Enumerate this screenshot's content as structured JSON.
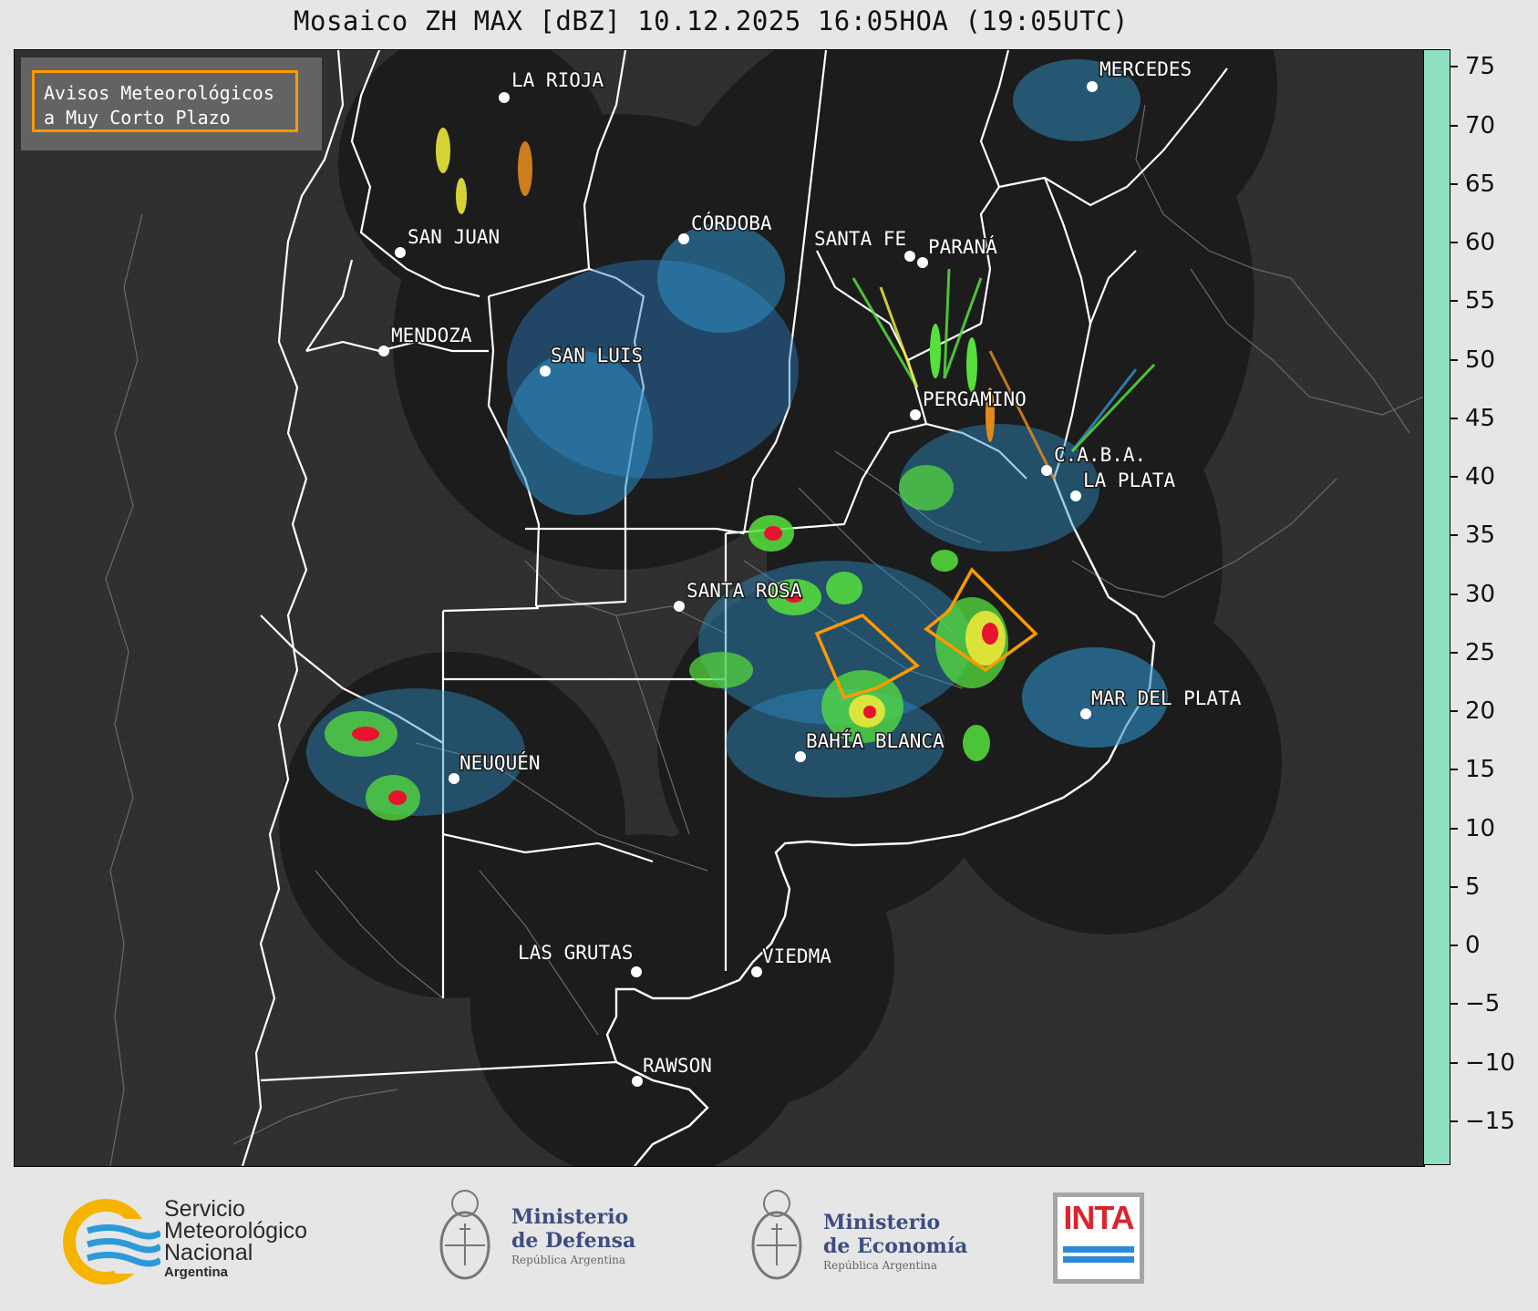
{
  "title": "Mosaico ZH MAX [dBZ] 10.12.2025 16:05HOA (19:05UTC)",
  "legend": {
    "line1": "Avisos Meteorológicos",
    "line2": "a Muy Corto Plazo",
    "border_color": "#ff9900"
  },
  "colorbar": {
    "ticks": [
      "75",
      "70",
      "65",
      "60",
      "55",
      "50",
      "45",
      "40",
      "35",
      "30",
      "25",
      "20",
      "15",
      "10",
      "5",
      "0",
      "−5",
      "−10",
      "−15"
    ],
    "tick_values": [
      75,
      70,
      65,
      60,
      55,
      50,
      45,
      40,
      35,
      30,
      25,
      20,
      15,
      10,
      5,
      0,
      -5,
      -10,
      -15
    ],
    "range": [
      -18.5,
      76.5
    ],
    "colors": [
      "#3b4a7d",
      "#3d5a93",
      "#3e6bab",
      "#3a7cbd",
      "#2d8fc8",
      "#26a8dc",
      "#56e03c",
      "#3fb62e",
      "#2a8f22",
      "#ebe83a",
      "#d4c12c",
      "#e08a1e",
      "#e8132f",
      "#a10000",
      "#d9007a",
      "#9a0090",
      "#ffffff",
      "#d9f5ea",
      "#8fe0c0"
    ],
    "color_thresholds": [
      -18.5,
      -10,
      0,
      5,
      10,
      15,
      19,
      25,
      28,
      30,
      35,
      38,
      43,
      48,
      52,
      56,
      58.5,
      60,
      66,
      76.5
    ]
  },
  "cities": [
    {
      "name": "LA RIOJA"
    },
    {
      "name": "MERCEDES"
    },
    {
      "name": "SAN JUAN"
    },
    {
      "name": "CÓRDOBA"
    },
    {
      "name": "SANTA FE"
    },
    {
      "name": "PARANÁ"
    },
    {
      "name": "MENDOZA"
    },
    {
      "name": "SAN LUIS"
    },
    {
      "name": "PERGAMINO"
    },
    {
      "name": "C.A.B.A."
    },
    {
      "name": "LA PLATA"
    },
    {
      "name": "SANTA ROSA"
    },
    {
      "name": "MAR DEL PLATA"
    },
    {
      "name": "NEUQUÉN"
    },
    {
      "name": "BAHÍA BLANCA"
    },
    {
      "name": "LAS GRUTAS"
    },
    {
      "name": "VIEDMA"
    },
    {
      "name": "RAWSON"
    }
  ],
  "footer": {
    "smn": {
      "line1": "Servicio",
      "line2": "Meteorológico",
      "line3": "Nacional",
      "line4": "Argentina"
    },
    "defensa": {
      "line1": "Ministerio",
      "line2": "de Defensa",
      "line3": "República Argentina"
    },
    "economia": {
      "line1": "Ministerio",
      "line2": "de Economía",
      "line3": "República Argentina"
    },
    "inta": {
      "text": "INTA"
    }
  },
  "colors": {
    "map_background": "#2f2f2f",
    "radar_coverage": "#1c1c1c",
    "page_background": "#e6e6e6",
    "warning_polygon": "#ff9900"
  }
}
